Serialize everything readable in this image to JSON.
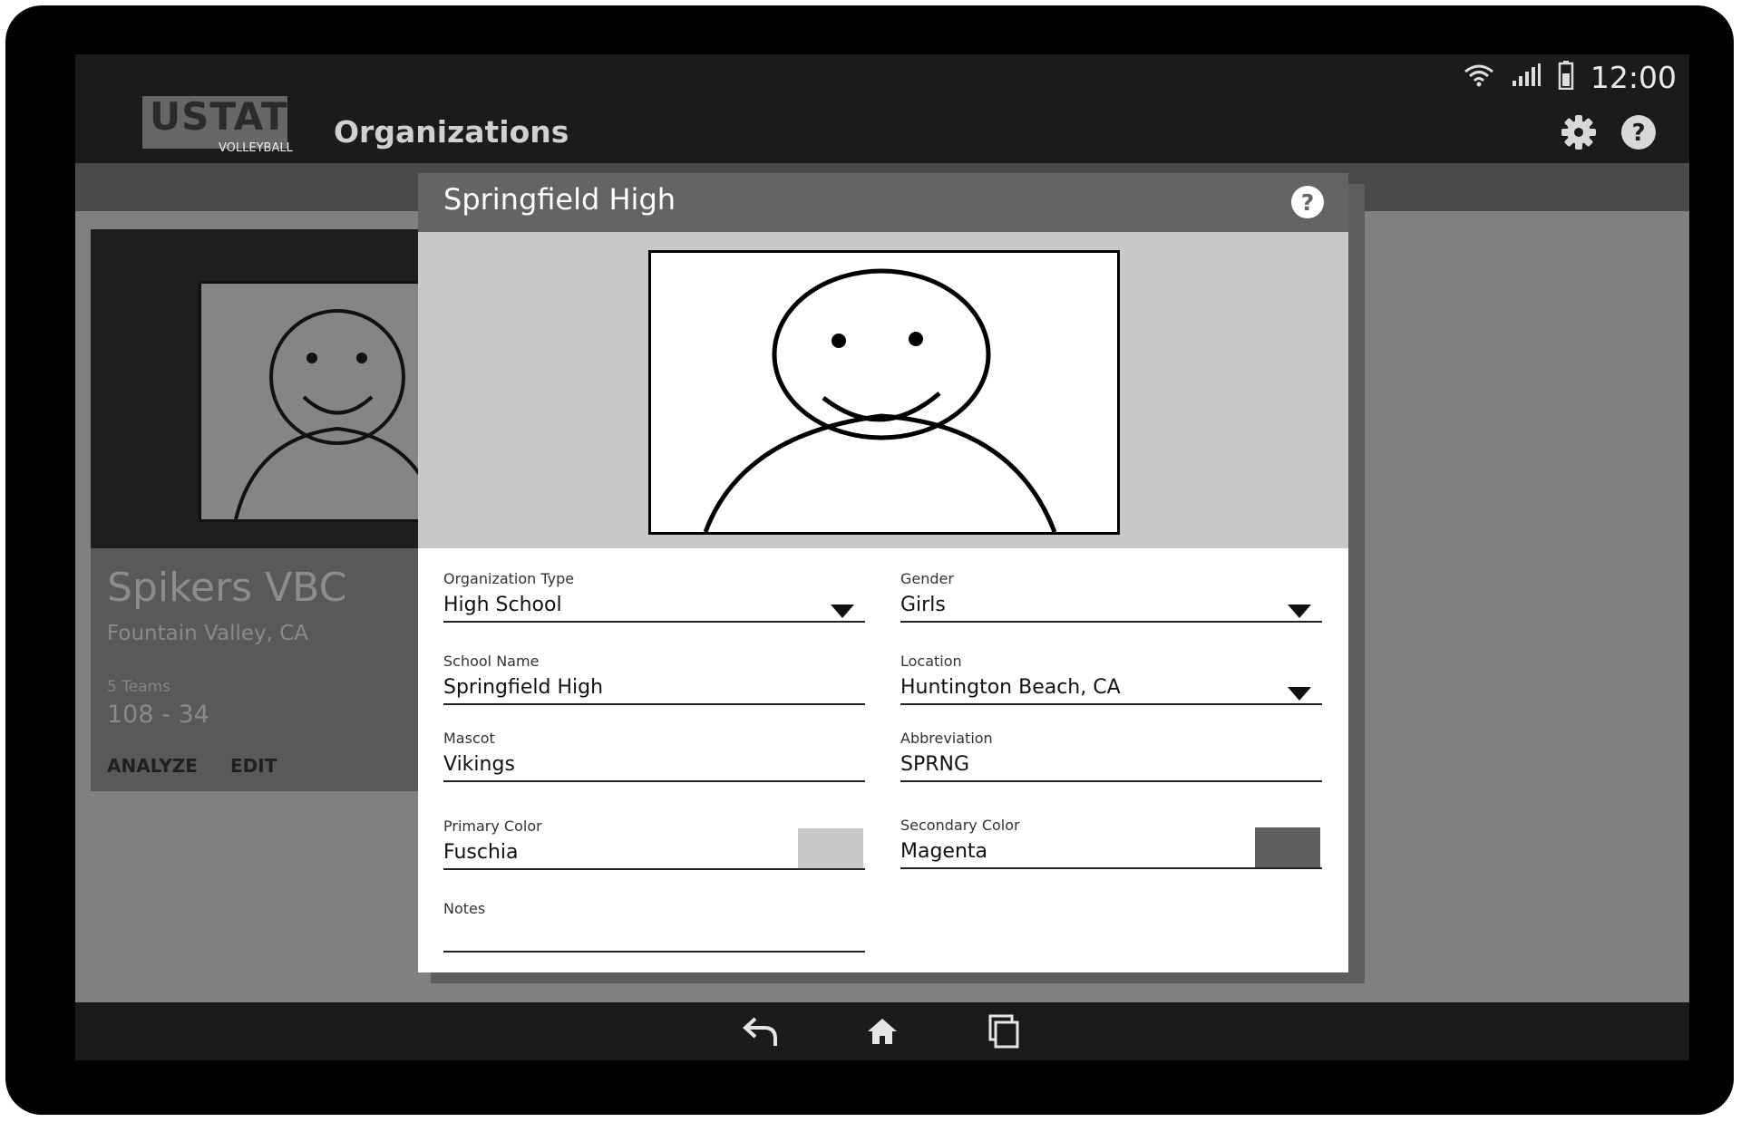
{
  "status": {
    "time": "12:00"
  },
  "app": {
    "logo_text": "USTAT",
    "logo_sub": "VOLLEYBALL",
    "title": "Organizations"
  },
  "card": {
    "name": "Spikers VBC",
    "location": "Fountain Valley, CA",
    "teams": "5 Teams",
    "record": "108 - 34",
    "analyze": "ANALYZE",
    "edit": "EDIT"
  },
  "dialog": {
    "title": "Springfield High",
    "fields": {
      "org_type": {
        "label": "Organization Type",
        "value": "High School"
      },
      "gender": {
        "label": "Gender",
        "value": "Girls"
      },
      "school_name": {
        "label": "School Name",
        "value": "Springfield High"
      },
      "location": {
        "label": "Location",
        "value": "Huntington Beach, CA"
      },
      "mascot": {
        "label": "Mascot",
        "value": "Vikings"
      },
      "abbreviation": {
        "label": "Abbreviation",
        "value": "SPRNG"
      },
      "primary_color": {
        "label": "Primary Color",
        "value": "Fuschia",
        "swatch": "#c8c8c8"
      },
      "secondary_color": {
        "label": "Secondary Color",
        "value": "Magenta",
        "swatch": "#5f5f5f"
      },
      "notes": {
        "label": "Notes",
        "value": ""
      }
    }
  },
  "icons": {
    "wifi": "wifi-icon",
    "signal": "signal-icon",
    "battery": "battery-icon",
    "settings": "gear-icon",
    "help": "help-icon",
    "back": "back-icon",
    "home": "home-icon",
    "recents": "recents-icon"
  }
}
